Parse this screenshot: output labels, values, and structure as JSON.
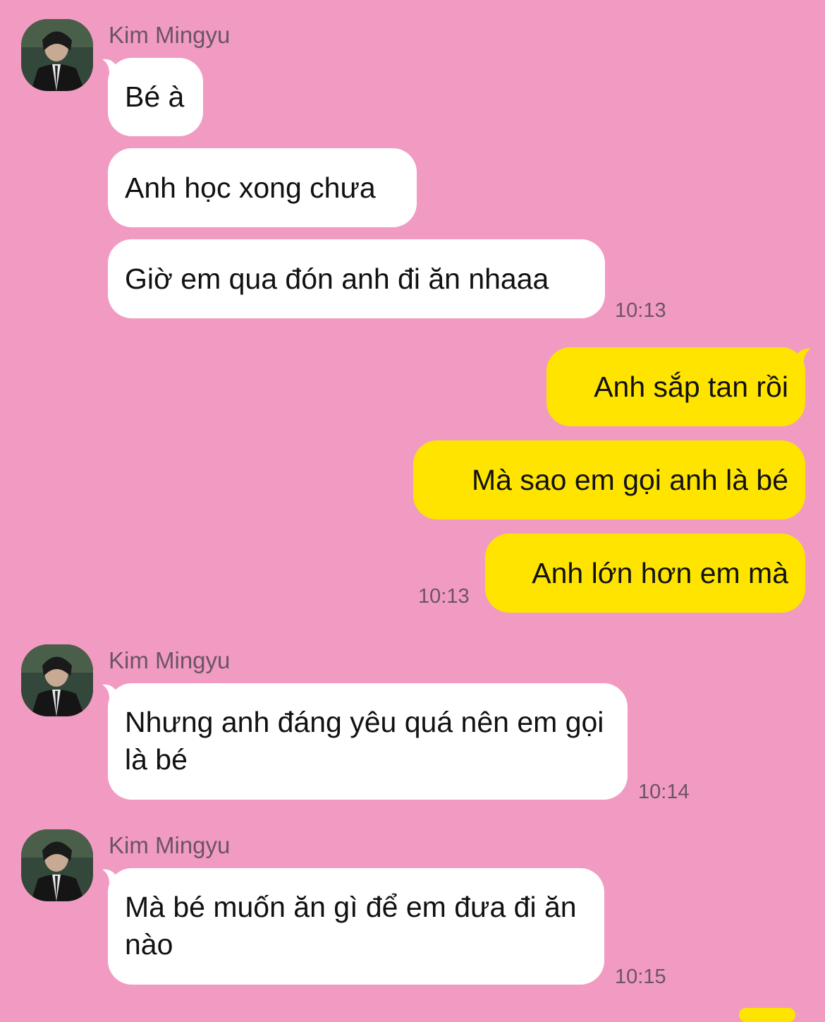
{
  "contact": {
    "name": "Kim Mingyu",
    "avatar_icon": "profile-photo"
  },
  "colors": {
    "background": "#f29bc2",
    "incoming_bubble": "#ffffff",
    "outgoing_bubble": "#ffe400"
  },
  "groups": [
    {
      "sender": "Kim Mingyu",
      "messages": [
        "Bé à",
        "Anh học xong chưa",
        "Giờ em qua đón anh đi ăn nhaaa"
      ],
      "time": "10:13"
    },
    {
      "sender": "me",
      "messages": [
        "Anh sắp tan rồi",
        "Mà sao em gọi anh là bé",
        "Anh lớn hơn em mà"
      ],
      "time": "10:13"
    },
    {
      "sender": "Kim Mingyu",
      "messages": [
        "Nhưng anh đáng yêu quá nên em gọi là bé"
      ],
      "time": "10:14"
    },
    {
      "sender": "Kim Mingyu",
      "messages": [
        "Mà bé muốn ăn gì để em đưa đi ăn nào"
      ],
      "time": "10:15"
    }
  ]
}
